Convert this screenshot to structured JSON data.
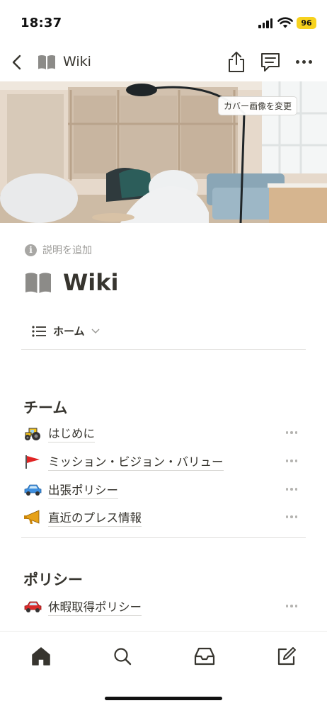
{
  "status_bar": {
    "time": "18:37",
    "battery": "96",
    "battery_color": "#f7d21e"
  },
  "nav": {
    "title": "Wiki",
    "icons": [
      "back-icon",
      "book-icon",
      "share-icon",
      "comment-icon",
      "more-icon"
    ]
  },
  "cover": {
    "change_button": "カバー画像を変更"
  },
  "page": {
    "add_description": "説明を追加",
    "title": "Wiki",
    "view_tab": "ホーム"
  },
  "sections": [
    {
      "title": "チーム",
      "items": [
        {
          "emoji": "tractor",
          "label": "はじめに"
        },
        {
          "emoji": "red-flag",
          "label": "ミッション・ビジョン・バリュー"
        },
        {
          "emoji": "blue-car",
          "label": "出張ポリシー"
        },
        {
          "emoji": "megaphone",
          "label": "直近のプレス情報"
        }
      ]
    },
    {
      "title": "ポリシー",
      "items": [
        {
          "emoji": "red-car",
          "label": "休暇取得ポリシー"
        }
      ]
    }
  ],
  "tab_bar": {
    "tabs": [
      "home-icon",
      "search-icon",
      "inbox-icon",
      "compose-icon"
    ]
  },
  "colors": {
    "text": "#37352f",
    "muted": "#9b9a97"
  }
}
